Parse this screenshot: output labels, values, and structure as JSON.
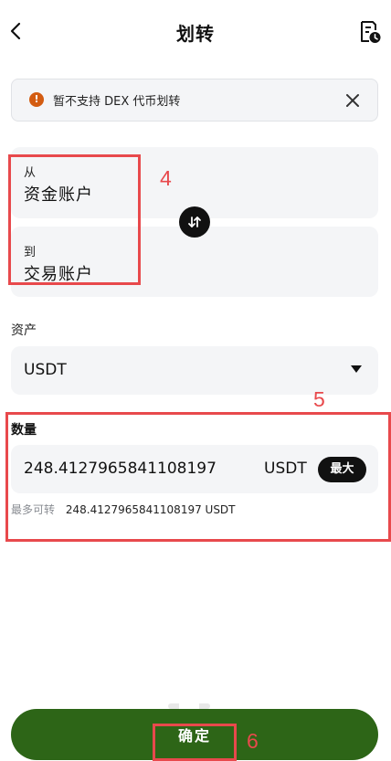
{
  "header": {
    "title": "划转",
    "back_icon": "chevron-left-icon",
    "history_icon": "document-clock-icon"
  },
  "notice": {
    "icon": "warning-icon",
    "icon_glyph": "!",
    "text": "暂不支持 DEX 代币划转",
    "close_icon": "close-icon",
    "accent_color": "#d35c11"
  },
  "transfer": {
    "from_label": "从",
    "from_value": "资金账户",
    "to_label": "到",
    "to_value": "交易账户",
    "swap_icon": "swap-vertical-icon"
  },
  "asset": {
    "label": "资产",
    "selected": "USDT",
    "dropdown_icon": "caret-down-icon"
  },
  "amount": {
    "label": "数量",
    "value": "248.4127965841108197",
    "unit": "USDT",
    "max_label": "最大",
    "available_label": "最多可转",
    "available_value": "248.4127965841108197 USDT"
  },
  "confirm": {
    "label": "确定",
    "color": "#2d6517"
  },
  "annotations": {
    "color": "#e8494c",
    "labels": [
      "4",
      "5",
      "6"
    ]
  }
}
